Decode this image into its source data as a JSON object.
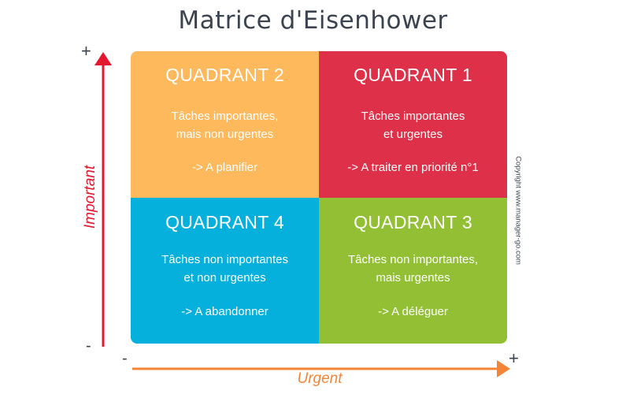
{
  "title": "Matrice d'Eisenhower",
  "colors": {
    "quadrant_1": "#de3149",
    "quadrant_2": "#fdb95c",
    "quadrant_3": "#92bf34",
    "quadrant_4": "#05b0dc",
    "important_axis": "#e5172f",
    "urgent_axis": "#f58436"
  },
  "quadrants": {
    "q2": {
      "name": "QUADRANT 2",
      "line1": "Tâches importantes,",
      "line2": "mais non urgentes",
      "action": "-> A planifier"
    },
    "q1": {
      "name": "QUADRANT 1",
      "line1": "Tâches importantes",
      "line2": "et urgentes",
      "action": "-> A traiter en priorité n°1"
    },
    "q4": {
      "name": "QUADRANT 4",
      "line1": "Tâches non importantes",
      "line2": "et non urgentes",
      "action": "-> A abandonner"
    },
    "q3": {
      "name": "QUADRANT 3",
      "line1": "Tâches non importantes,",
      "line2": "mais urgentes",
      "action": "-> A déléguer"
    }
  },
  "axes": {
    "y_label": "Important",
    "x_label": "Urgent",
    "y_plus": "+",
    "y_minus": "-",
    "x_minus": "-",
    "x_plus": "+"
  },
  "copyright": "Copyright www.manager-go.com"
}
